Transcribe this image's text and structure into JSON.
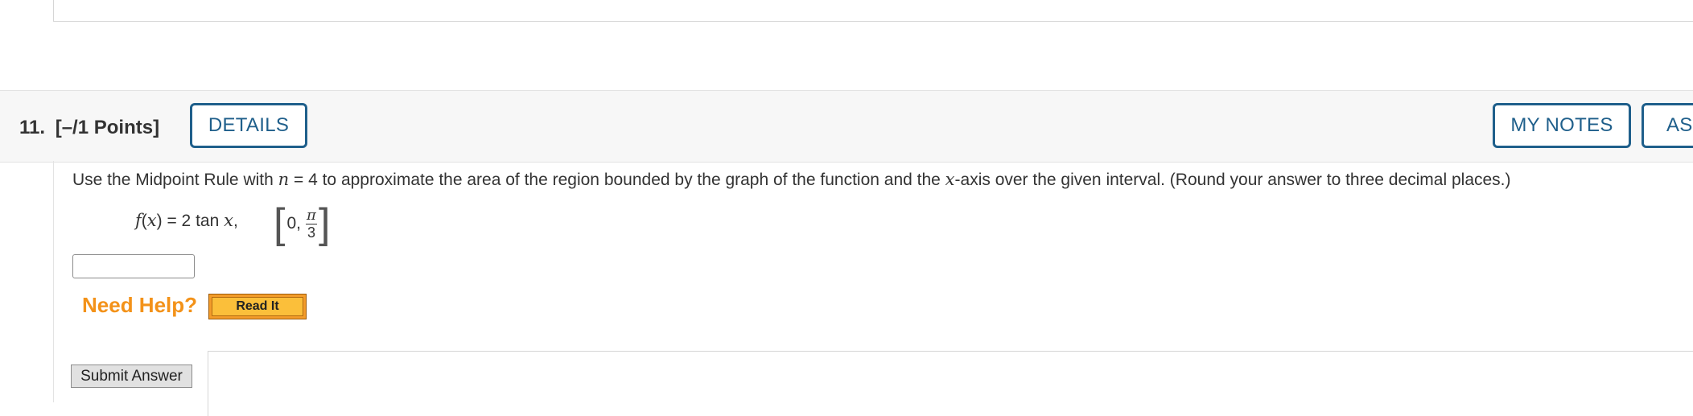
{
  "question": {
    "number_label": "11.",
    "points_label": "[–/1 Points]",
    "details_button": "DETAILS",
    "my_notes_button": "MY NOTES",
    "ask_button": "ASK YOUR TEACHER"
  },
  "prompt": {
    "part1": "Use the Midpoint Rule with ",
    "n_var": "n",
    "part2": " = 4 to approximate the area of the region bounded by the graph of the function and the ",
    "x_var": "x",
    "part3": "-axis over the given interval. (Round your answer to three decimal places.)"
  },
  "function": {
    "f": "f",
    "open_paren": "(",
    "x": "x",
    "eq": ") = 2 tan ",
    "x2": "x",
    "comma": ","
  },
  "interval": {
    "left_bracket": "[",
    "start": "0,",
    "numerator": "π",
    "denominator": "3",
    "right_bracket": "]"
  },
  "answer": {
    "value": "",
    "placeholder": ""
  },
  "help": {
    "label": "Need Help?",
    "read_it_button": "Read It"
  },
  "submit_button": "Submit Answer"
}
